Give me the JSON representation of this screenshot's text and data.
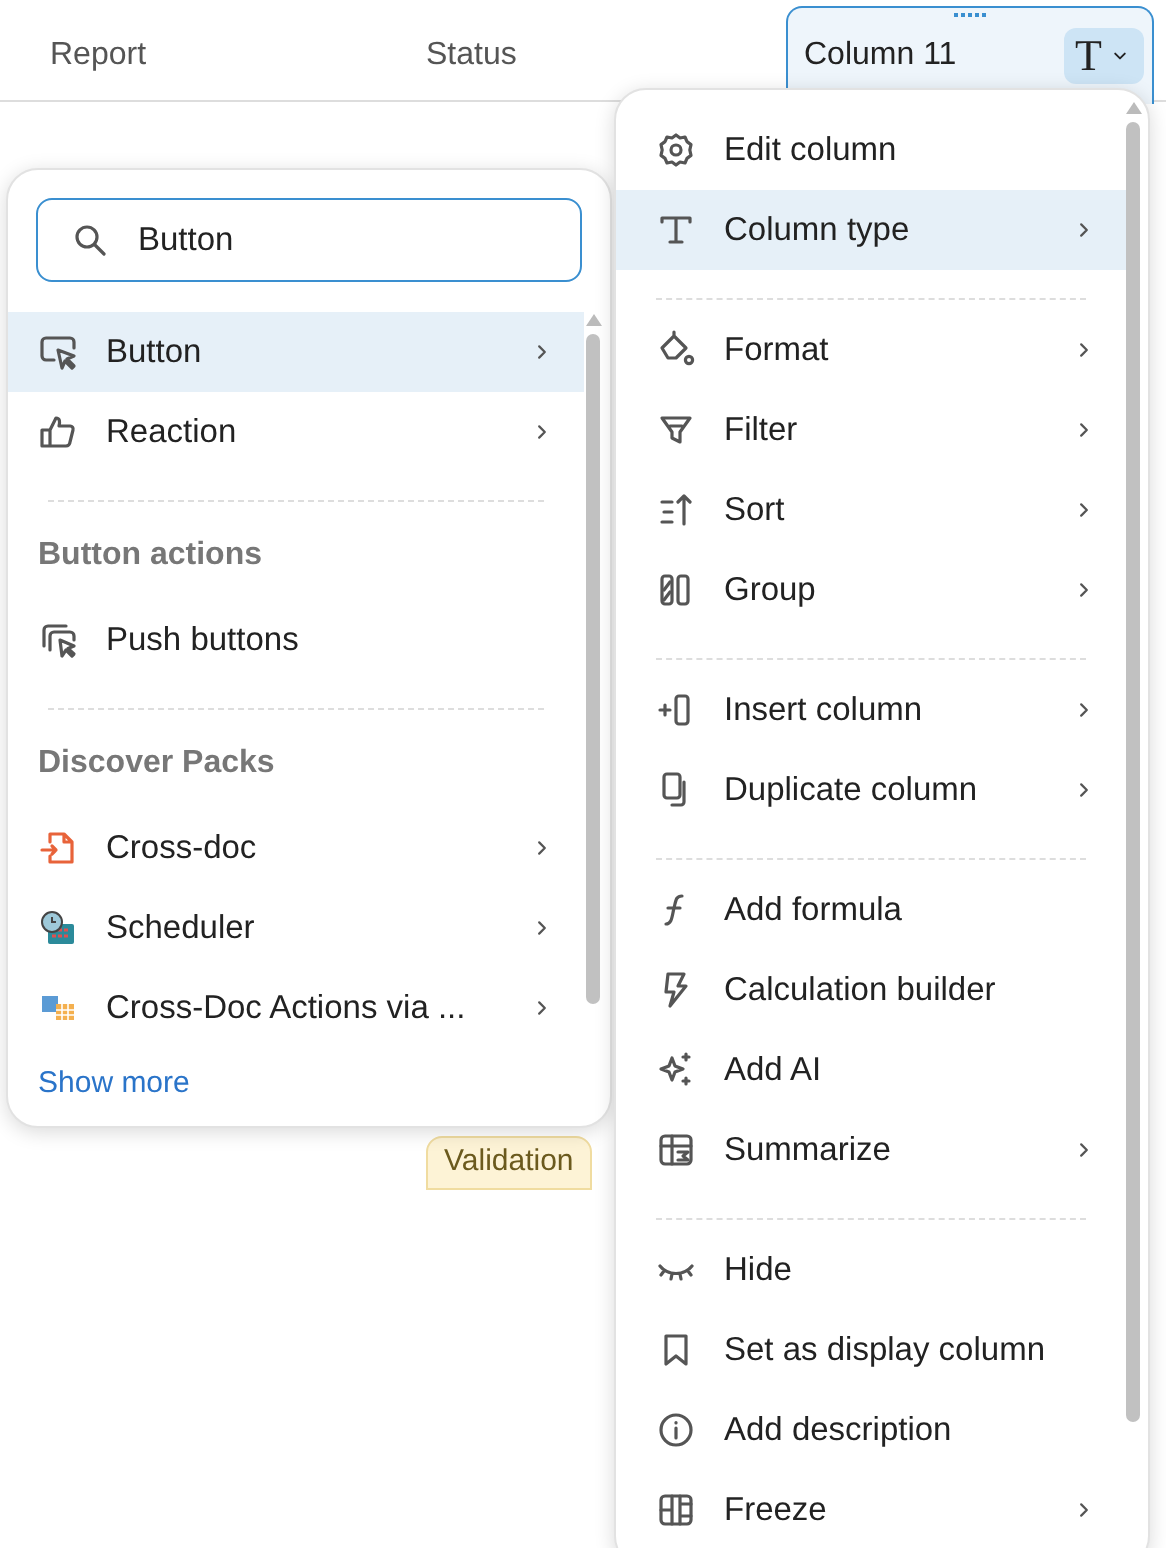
{
  "table": {
    "columns": [
      {
        "label": "Report",
        "selected": false
      },
      {
        "label": "Status",
        "selected": false
      },
      {
        "label": "Column 11",
        "selected": true,
        "type_symbol": "T"
      }
    ],
    "badge": "Validation"
  },
  "column_menu": {
    "items": [
      {
        "kind": "item",
        "label": "Edit column",
        "submenu": false,
        "selected": false
      },
      {
        "kind": "item",
        "label": "Column type",
        "submenu": true,
        "selected": true
      },
      {
        "kind": "divider"
      },
      {
        "kind": "item",
        "label": "Format",
        "submenu": true,
        "selected": false
      },
      {
        "kind": "item",
        "label": "Filter",
        "submenu": true,
        "selected": false
      },
      {
        "kind": "item",
        "label": "Sort",
        "submenu": true,
        "selected": false
      },
      {
        "kind": "item",
        "label": "Group",
        "submenu": true,
        "selected": false
      },
      {
        "kind": "divider"
      },
      {
        "kind": "item",
        "label": "Insert column",
        "submenu": true,
        "selected": false
      },
      {
        "kind": "item",
        "label": "Duplicate column",
        "submenu": true,
        "selected": false
      },
      {
        "kind": "divider"
      },
      {
        "kind": "item",
        "label": "Add formula",
        "submenu": false,
        "selected": false
      },
      {
        "kind": "item",
        "label": "Calculation builder",
        "submenu": false,
        "selected": false
      },
      {
        "kind": "item",
        "label": "Add AI",
        "submenu": false,
        "selected": false
      },
      {
        "kind": "item",
        "label": "Summarize",
        "submenu": true,
        "selected": false
      },
      {
        "kind": "divider"
      },
      {
        "kind": "item",
        "label": "Hide",
        "submenu": false,
        "selected": false
      },
      {
        "kind": "item",
        "label": "Set as display column",
        "submenu": false,
        "selected": false
      },
      {
        "kind": "item",
        "label": "Add description",
        "submenu": false,
        "selected": false
      },
      {
        "kind": "item",
        "label": "Freeze",
        "submenu": true,
        "selected": false
      }
    ]
  },
  "type_picker": {
    "search": {
      "value": "Button"
    },
    "items": [
      {
        "kind": "item",
        "label": "Button",
        "submenu": true,
        "selected": true
      },
      {
        "kind": "item",
        "label": "Reaction",
        "submenu": true,
        "selected": false
      },
      {
        "kind": "divider"
      },
      {
        "kind": "heading",
        "label": "Button actions"
      },
      {
        "kind": "item",
        "label": "Push buttons",
        "submenu": false,
        "selected": false
      },
      {
        "kind": "divider"
      },
      {
        "kind": "heading",
        "label": "Discover Packs"
      },
      {
        "kind": "item",
        "label": "Cross-doc",
        "submenu": true,
        "selected": false
      },
      {
        "kind": "item",
        "label": "Scheduler",
        "submenu": true,
        "selected": false
      },
      {
        "kind": "item",
        "label": "Cross-Doc Actions via ...",
        "submenu": true,
        "selected": false
      },
      {
        "kind": "link",
        "label": "Show more"
      }
    ]
  }
}
